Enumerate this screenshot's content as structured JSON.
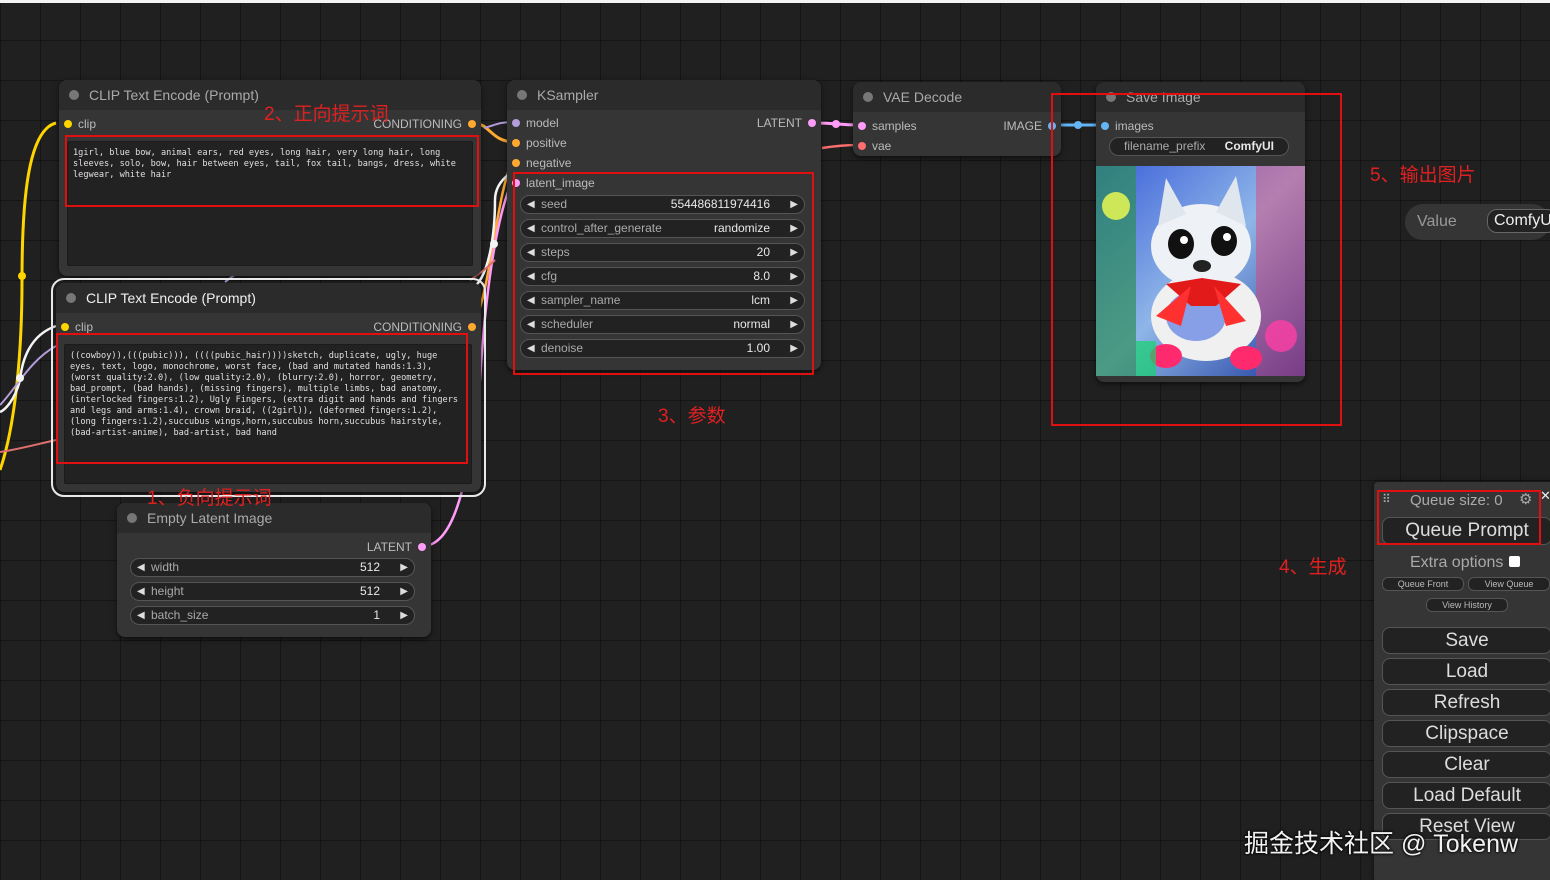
{
  "nodes": {
    "clip_pos": {
      "title": "CLIP Text Encode (Prompt)",
      "input": "clip",
      "output": "CONDITIONING",
      "text": "1girl, blue bow, animal ears, red eyes, long hair, very long hair, long sleeves, solo, bow, hair between eyes, tail, fox tail, bangs, dress, white legwear, white hair"
    },
    "clip_neg": {
      "title": "CLIP Text Encode (Prompt)",
      "input": "clip",
      "output": "CONDITIONING",
      "text": "((cowboy)),(((pubic))), ((((pubic_hair))))sketch, duplicate, ugly, huge eyes, text, logo, monochrome, worst face, (bad and mutated hands:1.3), (worst quality:2.0), (low quality:2.0), (blurry:2.0), horror, geometry, bad_prompt, (bad hands), (missing fingers), multiple limbs, bad anatomy, (interlocked fingers:1.2), Ugly Fingers, (extra digit and hands and fingers and legs and arms:1.4), crown braid, ((2girl)), (deformed fingers:1.2), (long fingers:1.2),succubus wings,horn,succubus horn,succubus hairstyle, (bad-artist-anime), bad-artist, bad hand"
    },
    "ksampler": {
      "title": "KSampler",
      "inputs": [
        "model",
        "positive",
        "negative",
        "latent_image"
      ],
      "output": "LATENT",
      "widgets": [
        {
          "label": "seed",
          "value": "554486811974416"
        },
        {
          "label": "control_after_generate",
          "value": "randomize"
        },
        {
          "label": "steps",
          "value": "20"
        },
        {
          "label": "cfg",
          "value": "8.0"
        },
        {
          "label": "sampler_name",
          "value": "lcm"
        },
        {
          "label": "scheduler",
          "value": "normal"
        },
        {
          "label": "denoise",
          "value": "1.00"
        }
      ]
    },
    "vae_decode": {
      "title": "VAE Decode",
      "inputs": [
        "samples",
        "vae"
      ],
      "output": "IMAGE"
    },
    "save_image": {
      "title": "Save Image",
      "input": "images",
      "widget_label": "filename_prefix",
      "widget_value": "ComfyUI"
    },
    "empty_latent": {
      "title": "Empty Latent Image",
      "output": "LATENT",
      "widgets": [
        {
          "label": "width",
          "value": "512"
        },
        {
          "label": "height",
          "value": "512"
        },
        {
          "label": "batch_size",
          "value": "1"
        }
      ]
    }
  },
  "value_pill": {
    "label": "Value",
    "value": "ComfyU"
  },
  "annotations": {
    "positive": "2、正向提示词",
    "negative": "1、负向提示词",
    "params": "3、参数",
    "generate": "4、生成",
    "output": "5、输出图片"
  },
  "menu": {
    "queue_size": "Queue size: 0",
    "queue_prompt": "Queue Prompt",
    "extra_options": "Extra options",
    "queue_front": "Queue Front",
    "view_queue": "View Queue",
    "view_history": "View History",
    "buttons": [
      "Save",
      "Load",
      "Refresh",
      "Clipspace",
      "Clear",
      "Load Default",
      "Reset View"
    ]
  },
  "watermark": "掘金技术社区 @ Tokenw",
  "icons": {
    "left_arrow": "◀",
    "right_arrow": "▶",
    "gear": "⚙",
    "close": "✕",
    "drag": "⠿"
  }
}
